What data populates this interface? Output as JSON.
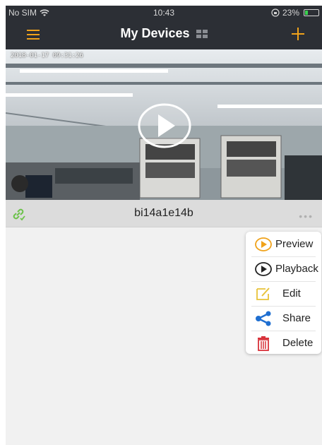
{
  "status_bar": {
    "carrier": "No SIM",
    "wifi_icon": "wifi-icon",
    "time": "10:43",
    "lock_icon": "orientation-lock-icon",
    "battery_percent": "23%",
    "battery_level": 0.23
  },
  "nav": {
    "title": "My Devices",
    "menu_icon": "hamburger-menu-icon",
    "grid_icon": "grid-view-icon",
    "add_icon": "plus-icon",
    "accent_color": "#f0a21a"
  },
  "video": {
    "timestamp": "2018-01-17 09:31:26",
    "play_icon": "play-icon"
  },
  "device": {
    "name": "bi14a1e14b",
    "status_icon": "link-connected-icon",
    "more_label": "•••"
  },
  "popup_menu": {
    "items": [
      {
        "label": "Preview",
        "icon": "preview-play-icon"
      },
      {
        "label": "Playback",
        "icon": "playback-icon"
      },
      {
        "label": "Edit",
        "icon": "edit-icon"
      },
      {
        "label": "Share",
        "icon": "share-icon"
      },
      {
        "label": "Delete",
        "icon": "trash-icon"
      }
    ]
  },
  "colors": {
    "header_bg": "#2c2f35",
    "accent": "#f0a21a",
    "share_blue": "#1f6fd1",
    "delete_red": "#d8323a",
    "link_green": "#6cc24a"
  }
}
